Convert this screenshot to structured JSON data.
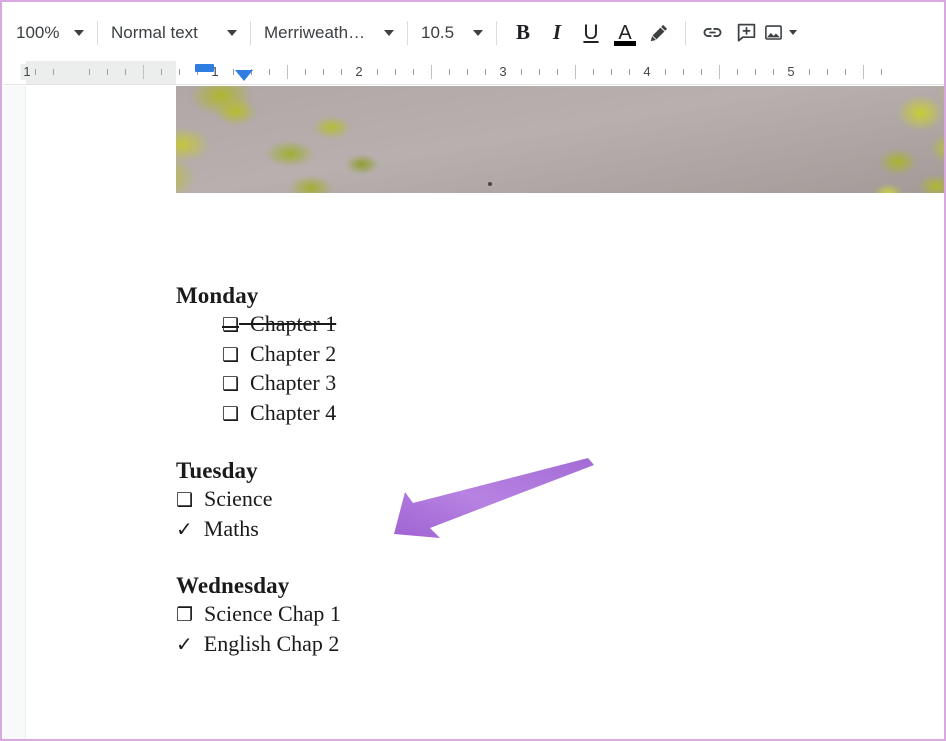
{
  "toolbar": {
    "zoom": {
      "value": "100%",
      "name": "zoom-level"
    },
    "paragraph_style": {
      "value": "Normal text"
    },
    "font": {
      "value": "Merriweath…"
    },
    "font_size": {
      "value": "10.5"
    },
    "bold": "B",
    "italic": "I",
    "underline": "U",
    "text_color": "A",
    "highlight_icon": "highlight-pen-icon",
    "link_icon": "insert-link-icon",
    "comment_icon": "add-comment-icon",
    "image_icon": "insert-image-icon"
  },
  "ruler": {
    "numbers": [
      "1",
      "2",
      "3",
      "4",
      "5"
    ],
    "unit": "inches",
    "left_indent_marker": "left-indent-marker",
    "first_line_indent_marker": "first-line-indent-marker",
    "marker_color": "#2f7de1"
  },
  "document": {
    "header_image": {
      "alt": "blurred photo of yellow-green foliage against a grey sky"
    },
    "sections": [
      {
        "heading": "Monday",
        "indented": true,
        "items": [
          {
            "marker": "❑",
            "text": "Chapter 1",
            "struck": true
          },
          {
            "marker": "❑",
            "text": "Chapter 2",
            "struck": false
          },
          {
            "marker": "❑",
            "text": "Chapter 3",
            "struck": false
          },
          {
            "marker": "❑",
            "text": "Chapter 4",
            "struck": false
          }
        ]
      },
      {
        "heading": "Tuesday",
        "indented": false,
        "items": [
          {
            "marker": "❑",
            "text": "Science",
            "struck": false
          },
          {
            "marker": "✓",
            "text": "Maths",
            "struck": false
          }
        ]
      },
      {
        "heading": "Wednesday",
        "indented": false,
        "items": [
          {
            "marker": "❐",
            "text": "Science Chap 1",
            "struck": false
          },
          {
            "marker": "✓",
            "text": "English Chap 2",
            "struck": false
          }
        ]
      }
    ]
  },
  "annotation": {
    "arrow": {
      "name": "purple-arrow-annotation",
      "color": "#ab73da",
      "points_to": "Chapter 4"
    }
  },
  "colors": {
    "screenshot_border": "#d9a8e0",
    "toolbar_text": "#3c4043",
    "ruler_margin": "#eceded",
    "page_background": "#ffffff",
    "canvas_background": "#f8f9fa"
  }
}
